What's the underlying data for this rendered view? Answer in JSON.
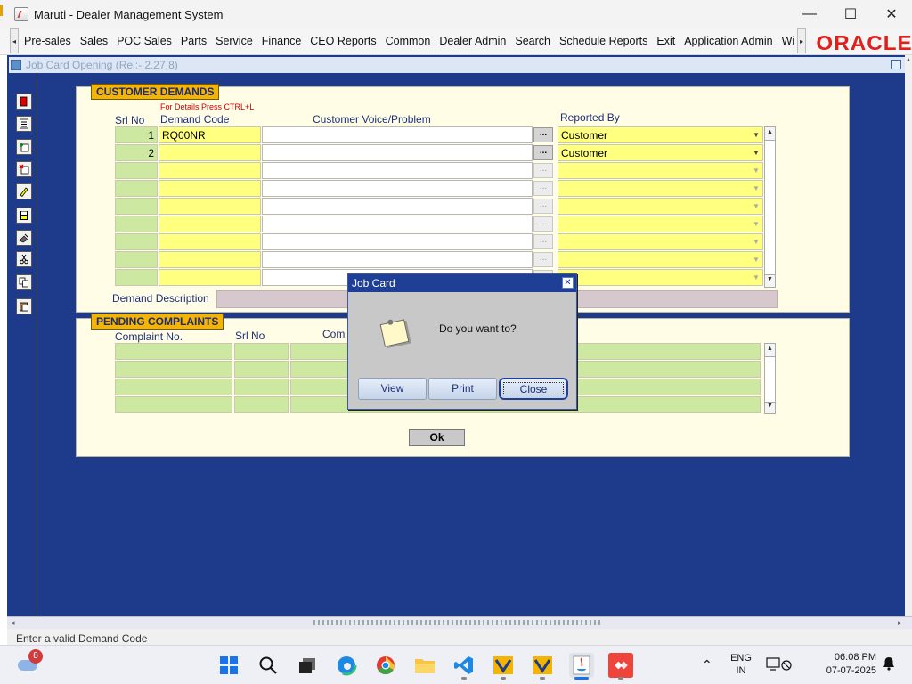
{
  "window": {
    "title": "Maruti - Dealer Management System",
    "controls": {
      "minimize": "—",
      "maximize": "☐",
      "close": "✕"
    }
  },
  "menu": {
    "items": [
      "Pre-sales",
      "Sales",
      "POC Sales",
      "Parts",
      "Service",
      "Finance",
      "CEO Reports",
      "Common",
      "Dealer Admin",
      "Search",
      "Schedule Reports",
      "Exit",
      "Application Admin",
      "Wi"
    ],
    "scroll_left": "◂",
    "scroll_right": "▸",
    "brand": "ORACLE"
  },
  "inner_window": {
    "title": "Job Card Opening (Rel:- 2.27.8)"
  },
  "toolbar_icons": [
    "exit-icon",
    "list-icon",
    "new-record-icon",
    "delete-record-icon",
    "edit-icon",
    "save-icon",
    "clear-icon",
    "cut-icon",
    "copy-icon",
    "paste-icon"
  ],
  "customer_demands": {
    "section_label": "CUSTOMER DEMANDS",
    "hint": "For Details Press CTRL+L",
    "col_srl": "Srl No",
    "col_code": "Demand Code",
    "col_voice": "Customer Voice/Problem",
    "col_reported": "Reported By",
    "rows": [
      {
        "srl": "1",
        "code": "RQ00NR",
        "voice": "",
        "reported": "Customer",
        "btn": "...",
        "arrow": "▼"
      },
      {
        "srl": "2",
        "code": "",
        "voice": "",
        "reported": "Customer",
        "btn": "...",
        "arrow": "▼"
      },
      {
        "srl": "",
        "code": "",
        "voice": "",
        "reported": "",
        "btn": "...",
        "arrow": "▼"
      },
      {
        "srl": "",
        "code": "",
        "voice": "",
        "reported": "",
        "btn": "...",
        "arrow": "▼"
      },
      {
        "srl": "",
        "code": "",
        "voice": "",
        "reported": "",
        "btn": "...",
        "arrow": "▼"
      },
      {
        "srl": "",
        "code": "",
        "voice": "",
        "reported": "",
        "btn": "...",
        "arrow": "▼"
      },
      {
        "srl": "",
        "code": "",
        "voice": "",
        "reported": "",
        "btn": "...",
        "arrow": "▼"
      },
      {
        "srl": "",
        "code": "",
        "voice": "",
        "reported": "",
        "btn": "...",
        "arrow": "▼"
      },
      {
        "srl": "",
        "code": "",
        "voice": "",
        "reported": "",
        "btn": "...",
        "arrow": "▼"
      }
    ],
    "demand_description_label": "Demand Description",
    "demand_description_value": ""
  },
  "pending_complaints": {
    "section_label": "PENDING COMPLAINTS",
    "col_no": "Complaint No.",
    "col_srl": "Srl No",
    "col_comp": "Com"
  },
  "ok_button": "Ok",
  "dialog": {
    "title": "Job Card",
    "close_glyph": "✕",
    "message": "Do you want to?",
    "buttons": [
      "View",
      "Print",
      "Close"
    ]
  },
  "status_bar": {
    "message": "Enter a valid Demand Code"
  },
  "taskbar": {
    "weather_badge": "8",
    "apps": [
      "windows-start-icon",
      "search-icon",
      "task-view-icon",
      "edge-icon",
      "chrome-icon",
      "file-explorer-icon",
      "vscode-icon",
      "app-icon-1",
      "app-icon-2",
      "java-icon",
      "anydesk-icon"
    ],
    "tray_chevron": "⌃",
    "lang_line1": "ENG",
    "lang_line2": "IN",
    "time": "06:08 PM",
    "date": "07-07-2025"
  },
  "colors": {
    "inner_background": "#1e3a8a",
    "panel_background": "#fffde6",
    "section_label": "#f5b400",
    "srl_cell": "#cde8a0",
    "code_cell": "#ffff80",
    "oracle_red": "#e0201b",
    "dialog_title": "#1f3f97"
  }
}
